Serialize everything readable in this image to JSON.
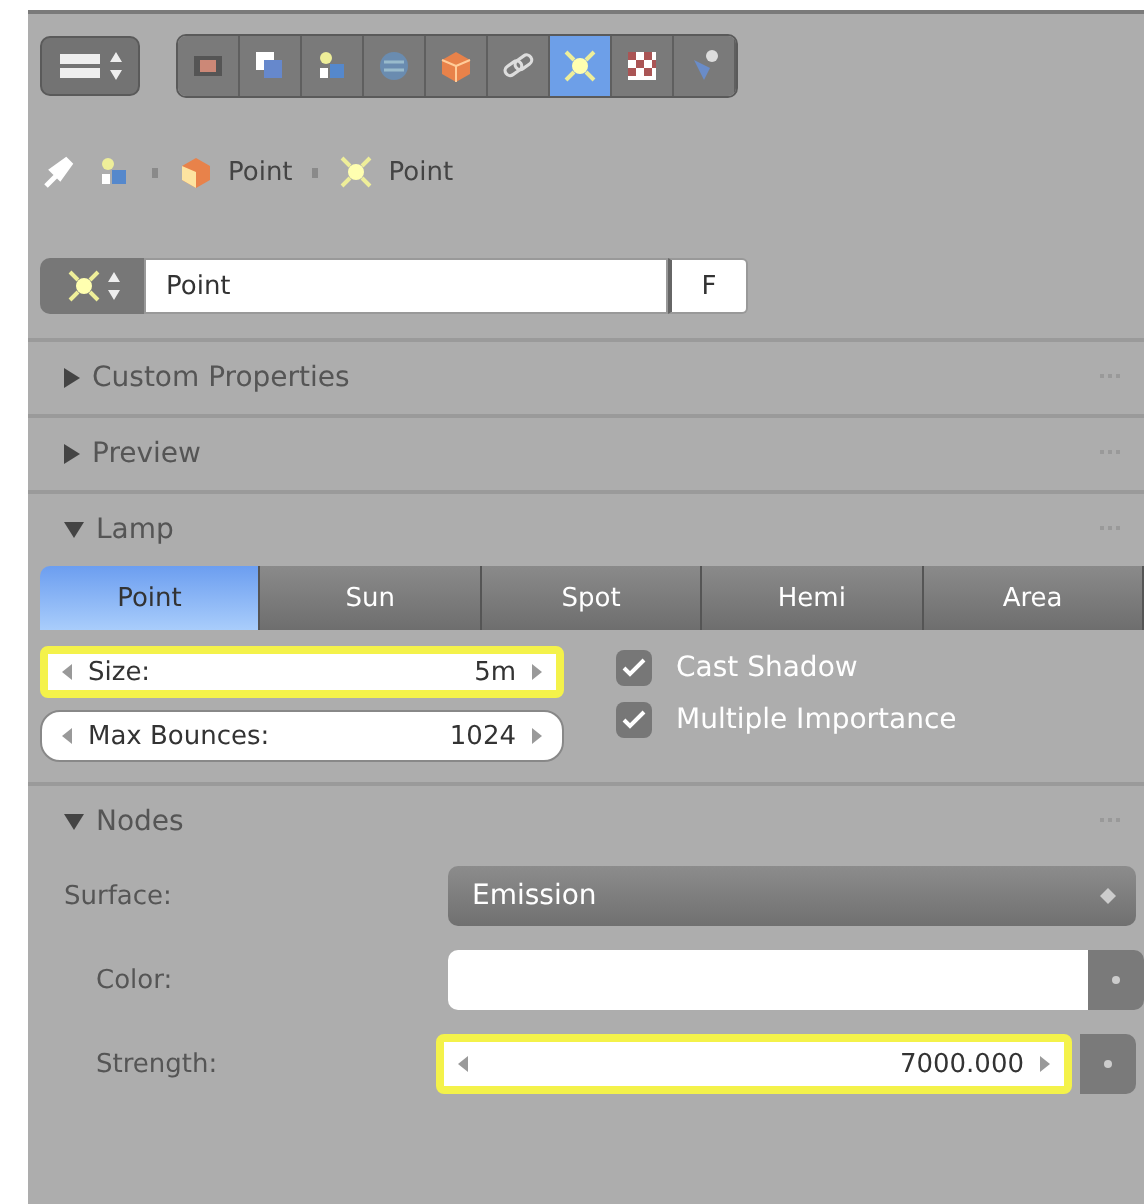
{
  "context_tabs": [
    {
      "selected": false
    },
    {
      "selected": false
    },
    {
      "selected": false
    },
    {
      "selected": false
    },
    {
      "selected": false
    },
    {
      "selected": false
    },
    {
      "selected": true
    },
    {
      "selected": false
    },
    {
      "selected": false
    }
  ],
  "breadcrumb": [
    {
      "label": "Point",
      "kind": "object"
    },
    {
      "label": "Point",
      "kind": "lamp"
    }
  ],
  "datablock": {
    "name": "Point",
    "fake_user_button": "F"
  },
  "panels": [
    {
      "title": "Custom Properties",
      "expanded": false
    },
    {
      "title": "Preview",
      "expanded": false
    },
    {
      "title": "Lamp",
      "expanded": true,
      "kind": "lamp"
    },
    {
      "title": "Nodes",
      "expanded": true,
      "kind": "nodes"
    }
  ],
  "lamp": {
    "types": [
      {
        "label": "Point",
        "selected": true
      },
      {
        "label": "Sun",
        "selected": false
      },
      {
        "label": "Spot",
        "selected": false
      },
      {
        "label": "Hemi",
        "selected": false
      },
      {
        "label": "Area",
        "selected": false
      }
    ],
    "fields": [
      {
        "label": "Size:",
        "value": "5m",
        "highlighted": true
      },
      {
        "label": "Max Bounces:",
        "value": "1024",
        "highlighted": false
      }
    ],
    "checkboxes": [
      {
        "label": "Cast Shadow",
        "checked": true
      },
      {
        "label": "Multiple Importance",
        "checked": true
      }
    ]
  },
  "nodes": {
    "surface": {
      "label": "Surface:",
      "value": "Emission"
    },
    "color": {
      "label": "Color:"
    },
    "strength": {
      "label": "Strength:",
      "value": "7000.000",
      "highlighted": true
    }
  }
}
